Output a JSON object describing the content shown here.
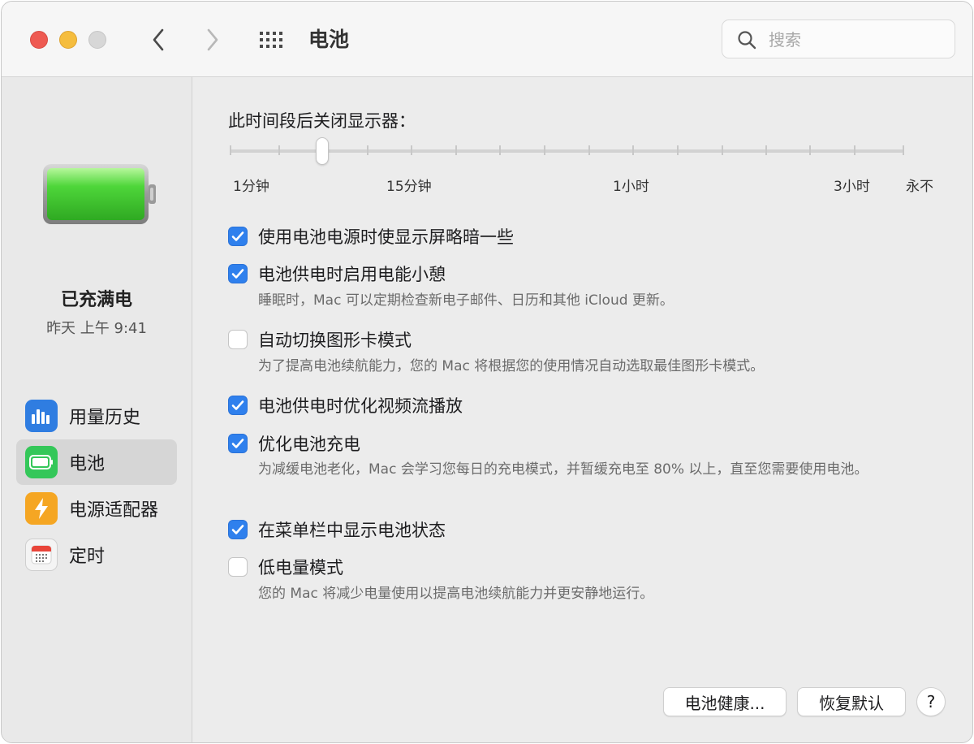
{
  "window": {
    "title": "电池",
    "search_placeholder": "搜索"
  },
  "sidebar": {
    "status_title": "已充满电",
    "status_time": "昨天 上午 9:41",
    "items": [
      {
        "label": "用量历史",
        "icon": "bar-chart-icon",
        "color": "#2f7de1",
        "selected": false
      },
      {
        "label": "电池",
        "icon": "battery-icon",
        "color": "#34c759",
        "selected": true
      },
      {
        "label": "电源适配器",
        "icon": "bolt-icon",
        "color": "#f5a623",
        "selected": false
      },
      {
        "label": "定时",
        "icon": "calendar-icon",
        "color": "#f2f2f2",
        "selected": false
      }
    ]
  },
  "main": {
    "slider": {
      "label": "此时间段后关闭显示器：",
      "ticks": [
        "1分钟",
        "15分钟",
        "1小时",
        "3小时",
        "永不"
      ],
      "selected_position": "2 of 17 ticks"
    },
    "options": [
      {
        "label": "使用电池电源时使显示屏略暗一些",
        "checked": true
      },
      {
        "label": "电池供电时启用电能小憩",
        "checked": true,
        "description": "睡眠时，Mac 可以定期检查新电子邮件、日历和其他 iCloud 更新。"
      },
      {
        "label": "自动切换图形卡模式",
        "checked": false,
        "description": "为了提高电池续航能力，您的 Mac 将根据您的使用情况自动选取最佳图形卡模式。"
      },
      {
        "label": "电池供电时优化视频流播放",
        "checked": true
      },
      {
        "label": "优化电池充电",
        "checked": true,
        "description": "为减缓电池老化，Mac 会学习您每日的充电模式，并暂缓充电至 80% 以上，直至您需要使用电池。"
      },
      {
        "label": "在菜单栏中显示电池状态",
        "checked": true
      },
      {
        "label": "低电量模式",
        "checked": false,
        "description": "您的 Mac 将减少电量使用以提高电池续航能力并更安静地运行。"
      }
    ],
    "buttons": {
      "battery_health": "电池健康...",
      "restore_defaults": "恢复默认",
      "help": "?"
    }
  },
  "colors": {
    "accent": "#2f80ed",
    "battery_green": "#3ec93a"
  }
}
